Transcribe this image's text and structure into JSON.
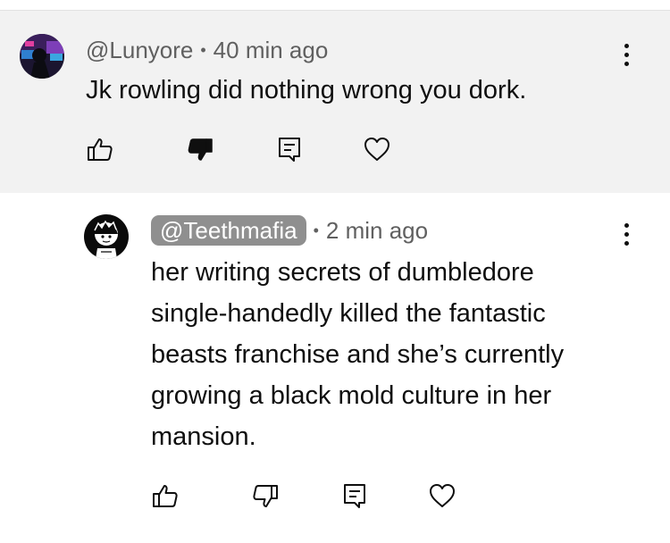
{
  "comments": [
    {
      "handle": "@Lunyore",
      "timestamp": "40 min ago",
      "text": "Jk rowling did nothing wrong you dork.",
      "disliked": true
    },
    {
      "handle": "@Teethmafia",
      "timestamp": "2 min ago",
      "text": "her writing secrets of dumbledore single-handedly killed the fantastic beasts franchise and she’s currently growing a black mold culture in her mansion.",
      "disliked": false
    }
  ],
  "separator": "•",
  "icons": {
    "like": "thumbs-up-icon",
    "dislike": "thumbs-down-icon",
    "reply": "reply-comment-icon",
    "heart": "heart-icon",
    "more": "more-vertical-icon"
  },
  "colors": {
    "parent_background": "#f2f2f2",
    "handle_chip": "#8f8f8f",
    "meta_text": "#606060"
  }
}
